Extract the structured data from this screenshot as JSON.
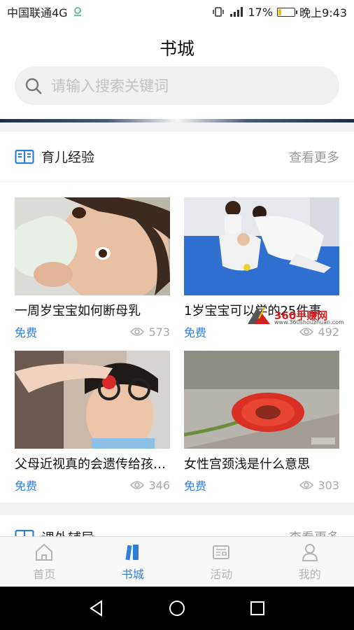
{
  "status": {
    "carrier": "中国联通4G",
    "battery": "17%",
    "time": "晚上9:43",
    "battery_level": 0.17
  },
  "header": {
    "title": "书城",
    "search_placeholder": "请输入搜索关键词"
  },
  "section": {
    "title": "育儿经验",
    "more": "查看更多",
    "items": [
      {
        "title": "一周岁宝宝如何断母乳",
        "price": "免费",
        "views": "573"
      },
      {
        "title": "1岁宝宝可以学的25件事",
        "price": "免费",
        "views": "492"
      },
      {
        "title": "父母近视真的会遗传给孩子吗",
        "price": "免费",
        "views": "346"
      },
      {
        "title": "女性宫颈浅是什么意思",
        "price": "免费",
        "views": "303"
      }
    ]
  },
  "section2": {
    "title": "课外辅导",
    "more": "查看更多"
  },
  "watermark": {
    "brand": "360手赚网",
    "url": "www.360shouzhuan.com"
  },
  "tabs": [
    {
      "label": "首页",
      "icon": "home-icon"
    },
    {
      "label": "书城",
      "icon": "books-icon"
    },
    {
      "label": "活动",
      "icon": "activity-icon"
    },
    {
      "label": "我的",
      "icon": "profile-icon"
    }
  ],
  "colors": {
    "accent": "#2f7ed8",
    "inactive": "#b4b4b4"
  }
}
